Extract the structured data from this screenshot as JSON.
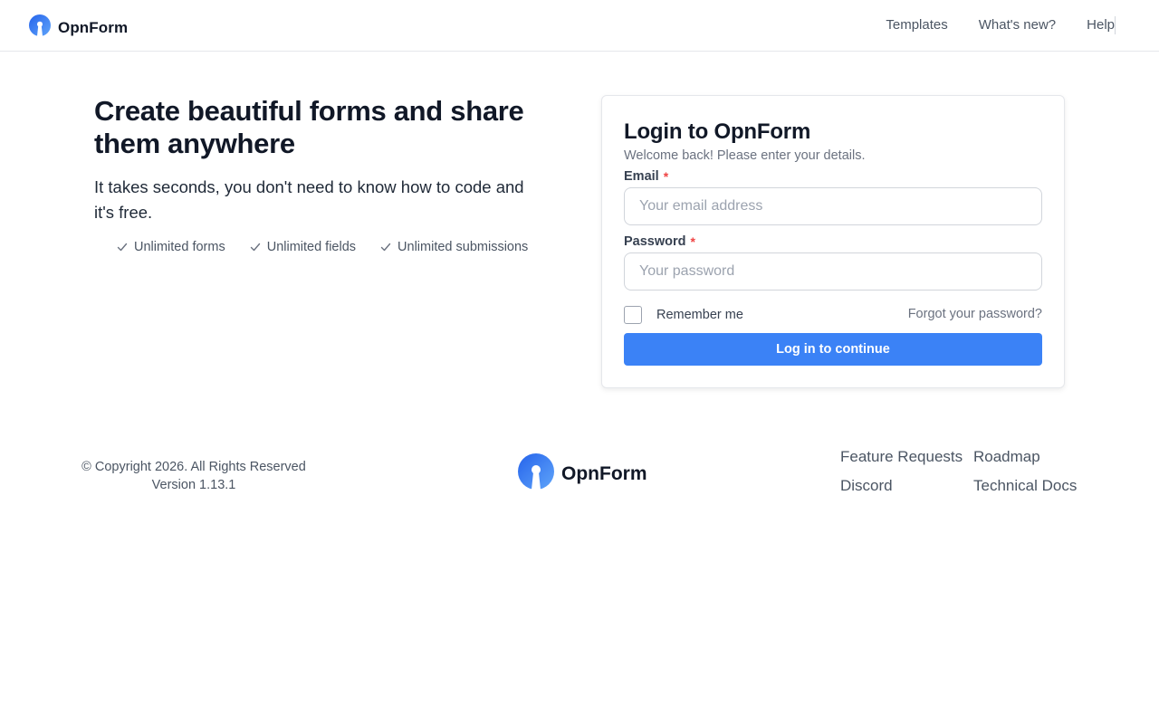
{
  "header": {
    "brand": "OpnForm",
    "nav": [
      {
        "label": "Templates"
      },
      {
        "label": "What's new?"
      },
      {
        "label": "Help"
      }
    ]
  },
  "hero": {
    "title": "Create beautiful forms and share them anywhere",
    "subtitle": "It takes seconds, you don't need to know how to code and it's free.",
    "features": [
      "Unlimited forms",
      "Unlimited fields",
      "Unlimited submissions"
    ]
  },
  "login": {
    "title": "Login to OpnForm",
    "subtitle": "Welcome back! Please enter your details.",
    "email_label": "Email",
    "email_placeholder": "Your email address",
    "email_value": "",
    "password_label": "Password",
    "password_placeholder": "Your password",
    "password_value": "",
    "required_mark": "*",
    "remember_label": "Remember me",
    "remember_checked": false,
    "forgot_label": "Forgot your password?",
    "submit_label": "Log in to continue"
  },
  "footer": {
    "copyright": "© Copyright 2026. All Rights Reserved",
    "version": "Version 1.13.1",
    "brand": "OpnForm",
    "links": [
      "Feature Requests",
      "Roadmap",
      "Discord",
      "Technical Docs"
    ]
  },
  "colors": {
    "accent": "#3b82f6",
    "required": "#ef4444",
    "logo_gradient_start": "#2563eb",
    "logo_gradient_end": "#60a5fa"
  },
  "icons": {
    "logo": "opnform-logo-icon",
    "feature_check": "check-icon"
  }
}
